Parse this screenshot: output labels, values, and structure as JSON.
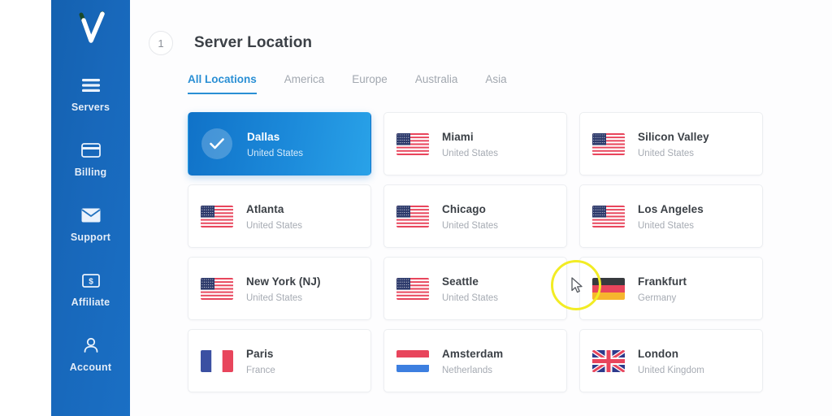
{
  "brand": {
    "logo_icon": "checkmark-logo",
    "sidebar_color": "#1868bb"
  },
  "sidebar": {
    "items": [
      {
        "label": "Servers",
        "icon": "list-icon"
      },
      {
        "label": "Billing",
        "icon": "credit-card-icon"
      },
      {
        "label": "Support",
        "icon": "envelope-icon"
      },
      {
        "label": "Affiliate",
        "icon": "dollar-bill-icon"
      },
      {
        "label": "Account",
        "icon": "user-icon"
      }
    ]
  },
  "header": {
    "step_number": "1",
    "title": "Server Location"
  },
  "tabs": [
    {
      "label": "All Locations",
      "active": true
    },
    {
      "label": "America",
      "active": false
    },
    {
      "label": "Europe",
      "active": false
    },
    {
      "label": "Australia",
      "active": false
    },
    {
      "label": "Asia",
      "active": false
    }
  ],
  "accent_color": "#2a8fd4",
  "locations": [
    {
      "city": "Dallas",
      "country": "United States",
      "flag": "us",
      "selected": true
    },
    {
      "city": "Miami",
      "country": "United States",
      "flag": "us",
      "selected": false
    },
    {
      "city": "Silicon Valley",
      "country": "United States",
      "flag": "us",
      "selected": false
    },
    {
      "city": "Atlanta",
      "country": "United States",
      "flag": "us",
      "selected": false
    },
    {
      "city": "Chicago",
      "country": "United States",
      "flag": "us",
      "selected": false
    },
    {
      "city": "Los Angeles",
      "country": "United States",
      "flag": "us",
      "selected": false
    },
    {
      "city": "New York (NJ)",
      "country": "United States",
      "flag": "us",
      "selected": false
    },
    {
      "city": "Seattle",
      "country": "United States",
      "flag": "us",
      "selected": false
    },
    {
      "city": "Frankfurt",
      "country": "Germany",
      "flag": "de",
      "selected": false
    },
    {
      "city": "Paris",
      "country": "France",
      "flag": "fr",
      "selected": false
    },
    {
      "city": "Amsterdam",
      "country": "Netherlands",
      "flag": "nl",
      "selected": false
    },
    {
      "city": "London",
      "country": "United Kingdom",
      "flag": "gb",
      "selected": false
    }
  ],
  "cursor": {
    "icon": "mouse-pointer-icon",
    "highlight_color": "#f2ec24"
  }
}
